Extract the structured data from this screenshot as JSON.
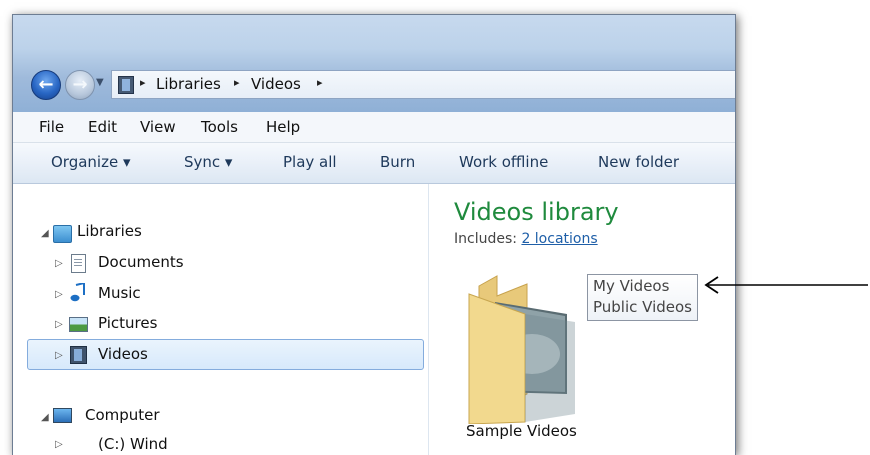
{
  "address_bar": {
    "crumbs": [
      "Libraries",
      "Videos"
    ],
    "separator": "▸"
  },
  "menu": {
    "items": [
      "File",
      "Edit",
      "View",
      "Tools",
      "Help"
    ]
  },
  "toolbar": {
    "organize": "Organize ▾",
    "sync": "Sync ▾",
    "play_all": "Play all",
    "burn": "Burn",
    "work_offline": "Work offline",
    "new_folder": "New folder"
  },
  "nav": {
    "libraries": "Libraries",
    "documents": "Documents",
    "music": "Music",
    "pictures": "Pictures",
    "videos": "Videos",
    "computer": "Computer",
    "drive": "(C:) Wind"
  },
  "library": {
    "title": "Videos library",
    "includes_label": "Includes:",
    "locations_link": "2 locations",
    "tooltip_lines": [
      "My Videos",
      "Public Videos"
    ],
    "folder_name": "Sample Videos"
  },
  "colors": {
    "accent_green": "#1f8a3d",
    "link_blue": "#1f5fa8",
    "selection": "#d7e9fb"
  }
}
